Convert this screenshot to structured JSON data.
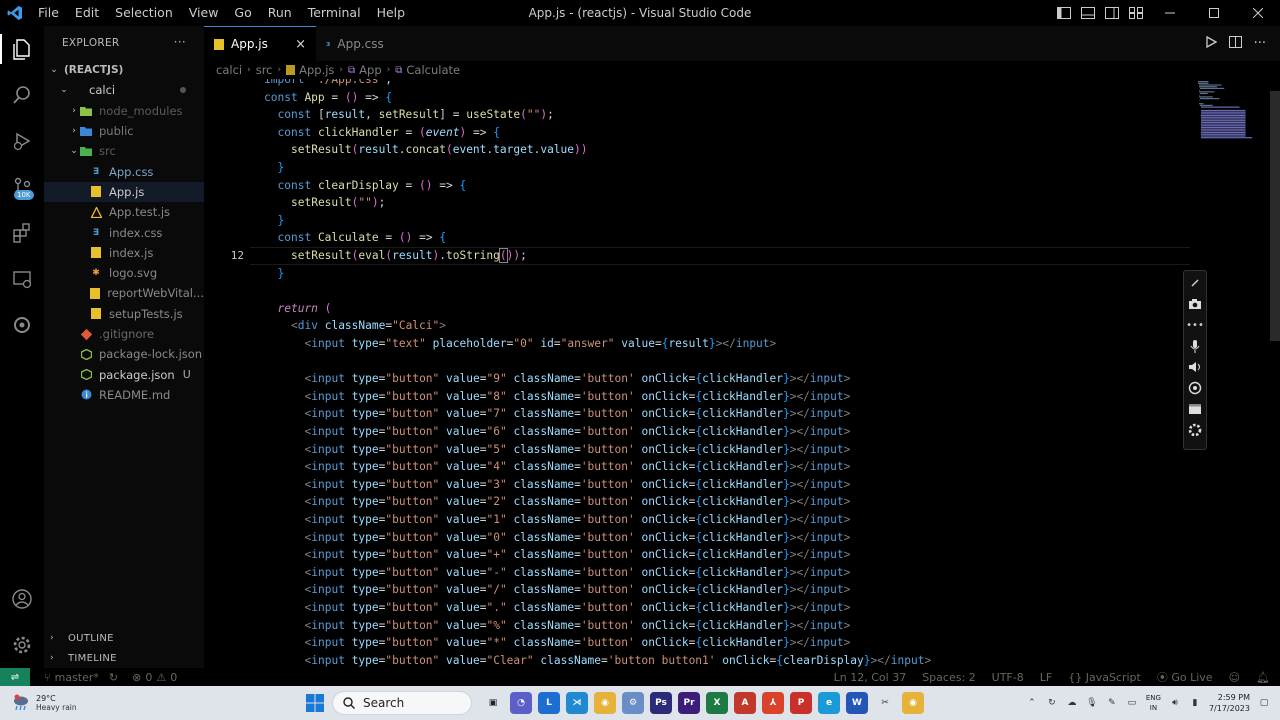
{
  "titlebar": {
    "title": "App.js - (reactjs) - Visual Studio Code",
    "menu": [
      "File",
      "Edit",
      "Selection",
      "View",
      "Go",
      "Run",
      "Terminal",
      "Help"
    ]
  },
  "activity": {
    "badge": "10K"
  },
  "explorer": {
    "header": "EXPLORER",
    "root": "(REACTJS)",
    "tree": [
      {
        "label": "calci",
        "kind": "folder-open",
        "depth": 1,
        "color": "#cccccc"
      },
      {
        "label": "node_modules",
        "kind": "folder",
        "depth": 2,
        "color": "#5a5a5a"
      },
      {
        "label": "public",
        "kind": "folder",
        "depth": 2,
        "color": "#7a7a7a"
      },
      {
        "label": "src",
        "kind": "folder-open",
        "depth": 2,
        "color": "#5a5a5a"
      },
      {
        "label": "App.css",
        "kind": "css",
        "depth": 3,
        "color": "#7fa5c9"
      },
      {
        "label": "App.js",
        "kind": "js",
        "depth": 3,
        "color": "#cccccc",
        "selected": true
      },
      {
        "label": "App.test.js",
        "kind": "test",
        "depth": 3,
        "color": "#8a8a8a"
      },
      {
        "label": "index.css",
        "kind": "css",
        "depth": 3,
        "color": "#8a8a8a"
      },
      {
        "label": "index.js",
        "kind": "js",
        "depth": 3,
        "color": "#8a8a8a"
      },
      {
        "label": "logo.svg",
        "kind": "svg",
        "depth": 3,
        "color": "#8a8a8a"
      },
      {
        "label": "reportWebVital...",
        "kind": "js",
        "depth": 3,
        "color": "#8a8a8a"
      },
      {
        "label": "setupTests.js",
        "kind": "js",
        "depth": 3,
        "color": "#8a8a8a"
      },
      {
        "label": ".gitignore",
        "kind": "git",
        "depth": 2,
        "color": "#6a6a6a"
      },
      {
        "label": "package-lock.json",
        "kind": "json",
        "depth": 2,
        "color": "#8a8a8a"
      },
      {
        "label": "package.json",
        "kind": "json",
        "depth": 2,
        "color": "#cccccc",
        "git": "U"
      },
      {
        "label": "README.md",
        "kind": "info",
        "depth": 2,
        "color": "#8a8a8a"
      }
    ],
    "outline": "OUTLINE",
    "timeline": "TIMELINE"
  },
  "tabs": [
    {
      "label": "App.js",
      "active": true
    },
    {
      "label": "App.css",
      "active": false
    }
  ],
  "breadcrumbs": [
    "calci",
    "src",
    "App.js",
    "App",
    "Calculate"
  ],
  "editor": {
    "lines": [
      {
        "ln": "",
        "code": "import './App.css';"
      },
      {
        "ln": "",
        "code": "const App = () => {"
      },
      {
        "ln": "",
        "code": "  const [result, setResult] = useState(\"\");"
      },
      {
        "ln": "",
        "code": "  const clickHandler = (event) => {"
      },
      {
        "ln": "",
        "code": "    setResult(result.concat(event.target.value))"
      },
      {
        "ln": "",
        "code": "  }"
      },
      {
        "ln": "",
        "code": "  const clearDisplay = () => {"
      },
      {
        "ln": "",
        "code": "    setResult(\"\");"
      },
      {
        "ln": "",
        "code": "  }"
      },
      {
        "ln": "",
        "code": "  const Calculate = () => {"
      },
      {
        "ln": "12",
        "code": "    setResult(eval(result).toString());",
        "current": true
      },
      {
        "ln": "",
        "code": "  }"
      },
      {
        "ln": "",
        "code": ""
      },
      {
        "ln": "",
        "code": "  return ("
      },
      {
        "ln": "",
        "code": "    <div className=\"Calci\">"
      },
      {
        "ln": "",
        "code": "      <input type=\"text\" placeholder=\"0\" id=\"answer\" value={result}></input>"
      },
      {
        "ln": "",
        "code": ""
      },
      {
        "ln": "",
        "code": "      <input type=\"button\" value=\"9\" className='button' onClick={clickHandler}></input>"
      },
      {
        "ln": "",
        "code": "      <input type=\"button\" value=\"8\" className='button' onClick={clickHandler}></input>"
      },
      {
        "ln": "",
        "code": "      <input type=\"button\" value=\"7\" className='button' onClick={clickHandler}></input>"
      },
      {
        "ln": "",
        "code": "      <input type=\"button\" value=\"6\" className='button' onClick={clickHandler}></input>"
      },
      {
        "ln": "",
        "code": "      <input type=\"button\" value=\"5\" className='button' onClick={clickHandler}></input>"
      },
      {
        "ln": "",
        "code": "      <input type=\"button\" value=\"4\" className='button' onClick={clickHandler}></input>"
      },
      {
        "ln": "",
        "code": "      <input type=\"button\" value=\"3\" className='button' onClick={clickHandler}></input>"
      },
      {
        "ln": "",
        "code": "      <input type=\"button\" value=\"2\" className='button' onClick={clickHandler}></input>"
      },
      {
        "ln": "",
        "code": "      <input type=\"button\" value=\"1\" className='button' onClick={clickHandler}></input>"
      },
      {
        "ln": "",
        "code": "      <input type=\"button\" value=\"0\" className='button' onClick={clickHandler}></input>"
      },
      {
        "ln": "",
        "code": "      <input type=\"button\" value=\"+\" className='button' onClick={clickHandler}></input>"
      },
      {
        "ln": "",
        "code": "      <input type=\"button\" value=\"-\" className='button' onClick={clickHandler}></input>"
      },
      {
        "ln": "",
        "code": "      <input type=\"button\" value=\"/\" className='button' onClick={clickHandler}></input>"
      },
      {
        "ln": "",
        "code": "      <input type=\"button\" value=\".\" className='button' onClick={clickHandler}></input>"
      },
      {
        "ln": "",
        "code": "      <input type=\"button\" value=\"%\" className='button' onClick={clickHandler}></input>"
      },
      {
        "ln": "",
        "code": "      <input type=\"button\" value=\"*\" className='button' onClick={clickHandler}></input>"
      },
      {
        "ln": "",
        "code": "      <input type=\"button\" value=\"Clear\" className='button button1' onClick={clearDisplay}></input>"
      }
    ]
  },
  "statusbar": {
    "branch": "master*",
    "problems": "0",
    "warnings": "0",
    "position": "Ln 12, Col 37",
    "spaces": "Spaces: 2",
    "encoding": "UTF-8",
    "eol": "LF",
    "language": "JavaScript",
    "golive": "Go Live"
  },
  "taskbar": {
    "temp": "29°C",
    "weather": "Heavy rain",
    "search": "Search",
    "lang1": "ENG",
    "lang2": "IN",
    "time": "2:59 PM",
    "date": "7/17/2023"
  }
}
